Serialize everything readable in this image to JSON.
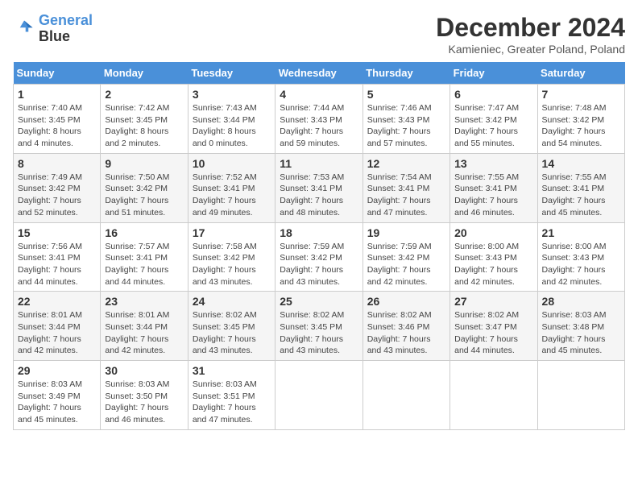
{
  "header": {
    "logo_line1": "General",
    "logo_line2": "Blue",
    "title": "December 2024",
    "location": "Kamieniec, Greater Poland, Poland"
  },
  "weekdays": [
    "Sunday",
    "Monday",
    "Tuesday",
    "Wednesday",
    "Thursday",
    "Friday",
    "Saturday"
  ],
  "weeks": [
    [
      {
        "day": "1",
        "sunrise": "7:40 AM",
        "sunset": "3:45 PM",
        "daylight": "8 hours and 4 minutes."
      },
      {
        "day": "2",
        "sunrise": "7:42 AM",
        "sunset": "3:45 PM",
        "daylight": "8 hours and 2 minutes."
      },
      {
        "day": "3",
        "sunrise": "7:43 AM",
        "sunset": "3:44 PM",
        "daylight": "8 hours and 0 minutes."
      },
      {
        "day": "4",
        "sunrise": "7:44 AM",
        "sunset": "3:43 PM",
        "daylight": "7 hours and 59 minutes."
      },
      {
        "day": "5",
        "sunrise": "7:46 AM",
        "sunset": "3:43 PM",
        "daylight": "7 hours and 57 minutes."
      },
      {
        "day": "6",
        "sunrise": "7:47 AM",
        "sunset": "3:42 PM",
        "daylight": "7 hours and 55 minutes."
      },
      {
        "day": "7",
        "sunrise": "7:48 AM",
        "sunset": "3:42 PM",
        "daylight": "7 hours and 54 minutes."
      }
    ],
    [
      {
        "day": "8",
        "sunrise": "7:49 AM",
        "sunset": "3:42 PM",
        "daylight": "7 hours and 52 minutes."
      },
      {
        "day": "9",
        "sunrise": "7:50 AM",
        "sunset": "3:42 PM",
        "daylight": "7 hours and 51 minutes."
      },
      {
        "day": "10",
        "sunrise": "7:52 AM",
        "sunset": "3:41 PM",
        "daylight": "7 hours and 49 minutes."
      },
      {
        "day": "11",
        "sunrise": "7:53 AM",
        "sunset": "3:41 PM",
        "daylight": "7 hours and 48 minutes."
      },
      {
        "day": "12",
        "sunrise": "7:54 AM",
        "sunset": "3:41 PM",
        "daylight": "7 hours and 47 minutes."
      },
      {
        "day": "13",
        "sunrise": "7:55 AM",
        "sunset": "3:41 PM",
        "daylight": "7 hours and 46 minutes."
      },
      {
        "day": "14",
        "sunrise": "7:55 AM",
        "sunset": "3:41 PM",
        "daylight": "7 hours and 45 minutes."
      }
    ],
    [
      {
        "day": "15",
        "sunrise": "7:56 AM",
        "sunset": "3:41 PM",
        "daylight": "7 hours and 44 minutes."
      },
      {
        "day": "16",
        "sunrise": "7:57 AM",
        "sunset": "3:41 PM",
        "daylight": "7 hours and 44 minutes."
      },
      {
        "day": "17",
        "sunrise": "7:58 AM",
        "sunset": "3:42 PM",
        "daylight": "7 hours and 43 minutes."
      },
      {
        "day": "18",
        "sunrise": "7:59 AM",
        "sunset": "3:42 PM",
        "daylight": "7 hours and 43 minutes."
      },
      {
        "day": "19",
        "sunrise": "7:59 AM",
        "sunset": "3:42 PM",
        "daylight": "7 hours and 42 minutes."
      },
      {
        "day": "20",
        "sunrise": "8:00 AM",
        "sunset": "3:43 PM",
        "daylight": "7 hours and 42 minutes."
      },
      {
        "day": "21",
        "sunrise": "8:00 AM",
        "sunset": "3:43 PM",
        "daylight": "7 hours and 42 minutes."
      }
    ],
    [
      {
        "day": "22",
        "sunrise": "8:01 AM",
        "sunset": "3:44 PM",
        "daylight": "7 hours and 42 minutes."
      },
      {
        "day": "23",
        "sunrise": "8:01 AM",
        "sunset": "3:44 PM",
        "daylight": "7 hours and 42 minutes."
      },
      {
        "day": "24",
        "sunrise": "8:02 AM",
        "sunset": "3:45 PM",
        "daylight": "7 hours and 43 minutes."
      },
      {
        "day": "25",
        "sunrise": "8:02 AM",
        "sunset": "3:45 PM",
        "daylight": "7 hours and 43 minutes."
      },
      {
        "day": "26",
        "sunrise": "8:02 AM",
        "sunset": "3:46 PM",
        "daylight": "7 hours and 43 minutes."
      },
      {
        "day": "27",
        "sunrise": "8:02 AM",
        "sunset": "3:47 PM",
        "daylight": "7 hours and 44 minutes."
      },
      {
        "day": "28",
        "sunrise": "8:03 AM",
        "sunset": "3:48 PM",
        "daylight": "7 hours and 45 minutes."
      }
    ],
    [
      {
        "day": "29",
        "sunrise": "8:03 AM",
        "sunset": "3:49 PM",
        "daylight": "7 hours and 45 minutes."
      },
      {
        "day": "30",
        "sunrise": "8:03 AM",
        "sunset": "3:50 PM",
        "daylight": "7 hours and 46 minutes."
      },
      {
        "day": "31",
        "sunrise": "8:03 AM",
        "sunset": "3:51 PM",
        "daylight": "7 hours and 47 minutes."
      },
      null,
      null,
      null,
      null
    ]
  ],
  "labels": {
    "sunrise": "Sunrise:",
    "sunset": "Sunset:",
    "daylight": "Daylight:"
  }
}
